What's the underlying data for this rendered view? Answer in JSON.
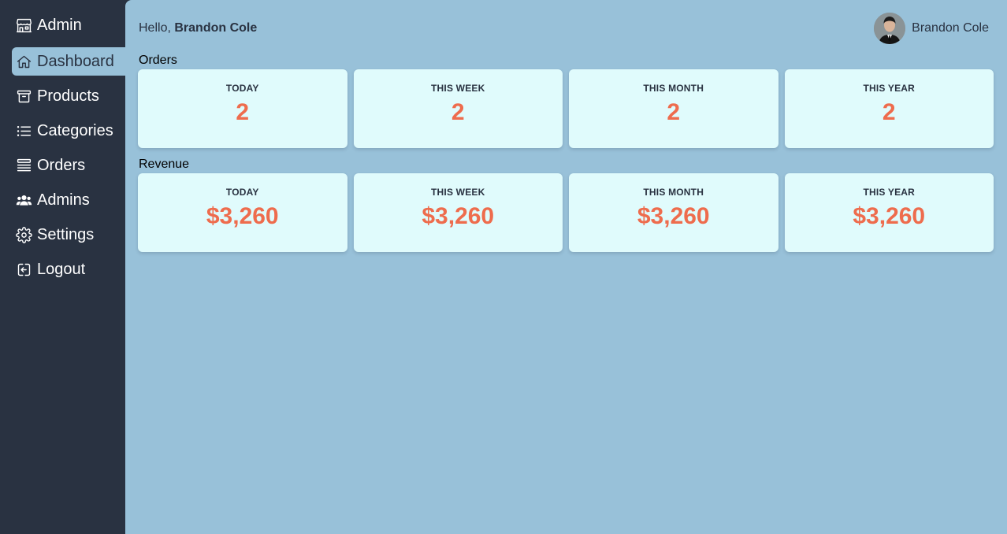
{
  "sidebar": {
    "brand": {
      "label": "Admin",
      "icon": "store-icon"
    },
    "items": [
      {
        "label": "Dashboard",
        "icon": "home-icon",
        "active": true
      },
      {
        "label": "Products",
        "icon": "archive-box-icon"
      },
      {
        "label": "Categories",
        "icon": "list-icon"
      },
      {
        "label": "Orders",
        "icon": "stack-icon"
      },
      {
        "label": "Admins",
        "icon": "users-icon"
      },
      {
        "label": "Settings",
        "icon": "gear-icon"
      },
      {
        "label": "Logout",
        "icon": "logout-icon"
      }
    ]
  },
  "header": {
    "greeting_prefix": "Hello,",
    "user_name": "Brandon Cole",
    "profile_name": "Brandon Cole"
  },
  "orders": {
    "title": "Orders",
    "cards": [
      {
        "label": "Today",
        "value": "2"
      },
      {
        "label": "This week",
        "value": "2"
      },
      {
        "label": "This month",
        "value": "2"
      },
      {
        "label": "This year",
        "value": "2"
      }
    ]
  },
  "revenue": {
    "title": "Revenue",
    "cards": [
      {
        "label": "Today",
        "value": "$3,260"
      },
      {
        "label": "This week",
        "value": "$3,260"
      },
      {
        "label": "This month",
        "value": "$3,260"
      },
      {
        "label": "This year",
        "value": "$3,260"
      }
    ]
  },
  "colors": {
    "sidebar_bg": "#293241",
    "main_bg": "#98c1d9",
    "card_bg": "#e0fbfc",
    "accent": "#ee6c4d",
    "text_dark": "#293241"
  }
}
